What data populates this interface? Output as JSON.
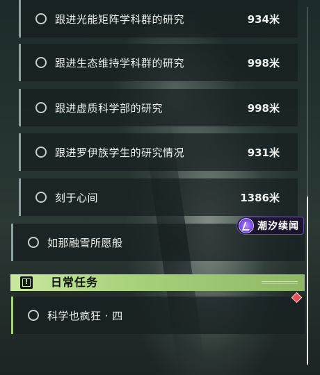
{
  "quests": [
    {
      "label": "跟进光能矩阵学科群的研究",
      "distance": "934米"
    },
    {
      "label": "跟进生态维持学科群的研究",
      "distance": "998米"
    },
    {
      "label": "跟进虚质科学部的研究",
      "distance": "998米"
    },
    {
      "label": "跟进罗伊族学生的研究情况",
      "distance": "931米"
    },
    {
      "label": "刻于心间",
      "distance": "1386米"
    }
  ],
  "standalone_quest": {
    "label": "如那融雪所愿般"
  },
  "tracker_badge": {
    "label": "潮汐续闻",
    "icon": "wave-emblem-icon"
  },
  "daily_section": {
    "title": "日常任务",
    "icon": "exclamation-box-icon",
    "items": [
      {
        "label": "科学也疯狂 · 四",
        "marker": "red-diamond-marker-icon"
      }
    ]
  },
  "colors": {
    "section_accent": "#a9d27c",
    "badge_purple": "#6c44d8",
    "marker_red": "#e8505a"
  }
}
